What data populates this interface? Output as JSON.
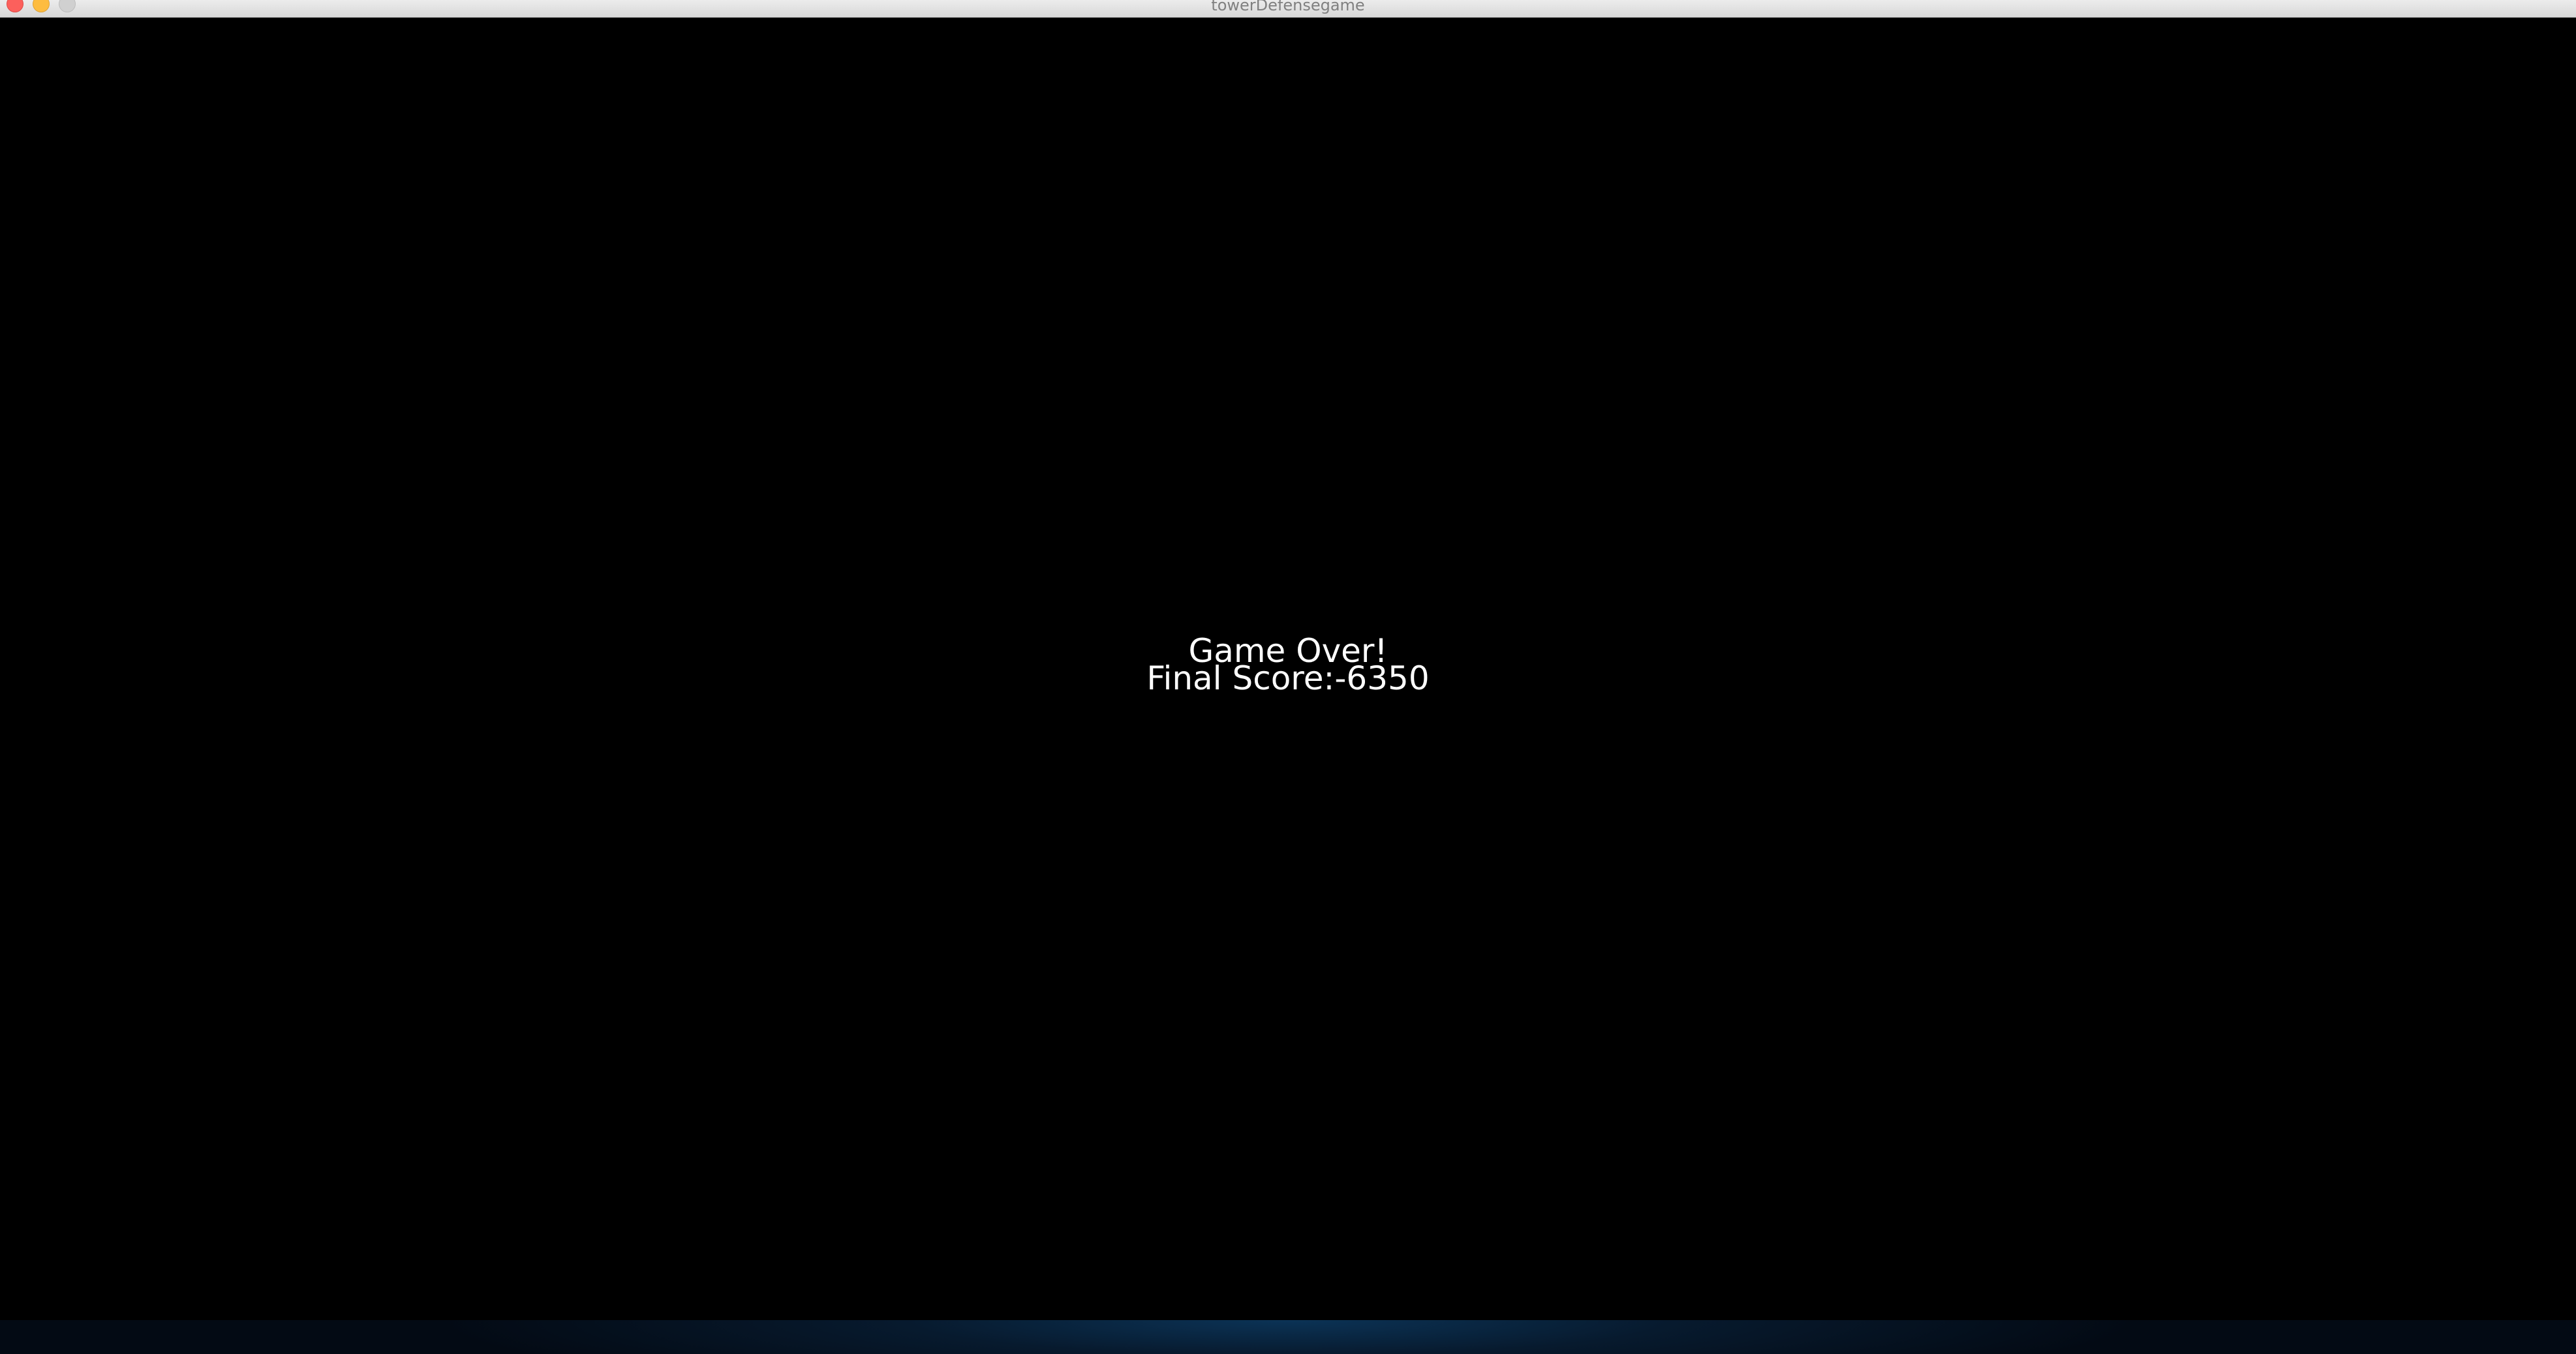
{
  "window": {
    "title": "towerDefensegame"
  },
  "game": {
    "headline": "Game Over!",
    "score_line": "Final Score:-6350"
  }
}
